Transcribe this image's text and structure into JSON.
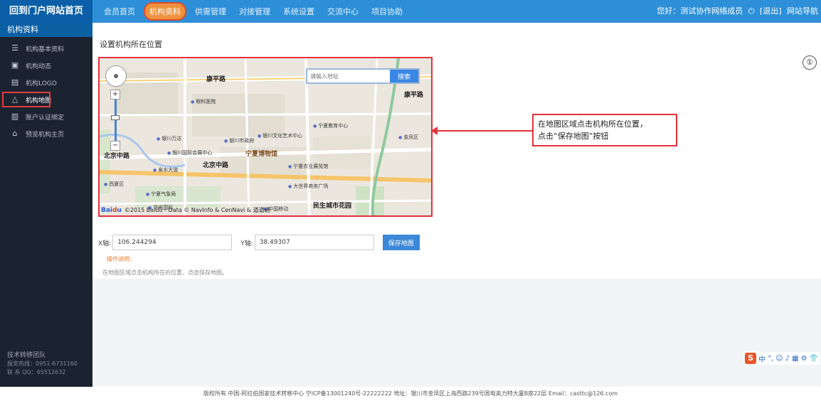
{
  "brand": {
    "title": "回到门户网站首页"
  },
  "topnav": {
    "items": [
      {
        "label": "会员首页"
      },
      {
        "label": "机构资料",
        "active": true
      },
      {
        "label": "供需管理"
      },
      {
        "label": "对接管理"
      },
      {
        "label": "系统设置"
      },
      {
        "label": "交流中心"
      },
      {
        "label": "项目协助"
      }
    ]
  },
  "userbar": {
    "greeting": "您好：测试协作网络成员",
    "logout": "[退出]",
    "site_link": "网站导航"
  },
  "sidebar": {
    "header": "机构资料",
    "items": [
      {
        "label": "机构基本资料",
        "icon": "profile-icon"
      },
      {
        "label": "机构动态",
        "icon": "news-icon"
      },
      {
        "label": "机构LOGO",
        "icon": "image-icon"
      },
      {
        "label": "机构地图",
        "icon": "map-pin-icon",
        "current": true
      },
      {
        "label": "账户认证绑定",
        "icon": "id-card-icon"
      },
      {
        "label": "预览机构主页",
        "icon": "home-icon"
      }
    ],
    "footer": {
      "title": "技术转移团队",
      "phone": "服务热线：0951-6731160",
      "qq": "联 系 QQ：65512632"
    }
  },
  "page": {
    "section_title": "设置机构所在位置",
    "corner_button": "①"
  },
  "map": {
    "search_placeholder": "请输入地址",
    "search_button": "搜索",
    "zoom_in": "+",
    "zoom_out": "−",
    "copyright": "©2015 Baidu - Data © NavInfo & CenNavi & 道道通",
    "roads": [
      "康平路",
      "北京中路",
      "康平路",
      "北京中路"
    ],
    "areas": [
      "宁夏博物馆",
      "民生城市花园"
    ],
    "labels": [
      "银川万达",
      "宁夏教育中心",
      "银川市政府",
      "银川国际会展中心",
      "宁夏农业展览馆",
      "大世界商务广场",
      "宁夏气象局",
      "华电国际",
      "中国移动",
      "眼科医院",
      "银川文化艺术中心",
      "金凤区",
      "亲水大道",
      "西夏区"
    ]
  },
  "callout": {
    "line1": "在地图区域点击机构所在位置，",
    "line2": "点击“保存地图”按钮"
  },
  "coords": {
    "x_label": "X轴:",
    "x_value": "106.244294",
    "y_label": "Y轴:",
    "y_value": "38.49307",
    "save_button": "保存地图"
  },
  "note": {
    "title": "操作说明：",
    "text": "在地图区域点击机构所在的位置，点击保存地图。"
  },
  "imebar": {
    "logo": "S",
    "items": [
      "中",
      "°,",
      "☺",
      "♪",
      "▦",
      "⚙",
      "👕"
    ]
  },
  "footer": {
    "text": "版权所有 中国-阿拉伯国家技术转移中心 宁ICP备13001240号-22222222   地址：银川市金凤区上海西路239号国电英力特大厦B座22层 Email：casttc@126.com"
  },
  "colors": {
    "topbar": "#2d8fd8",
    "brand": "#0a5fa8",
    "sidebar": "#1c2330",
    "highlight": "#e0333c",
    "accent_orange": "#f0913f",
    "button_blue": "#3b87d8"
  }
}
